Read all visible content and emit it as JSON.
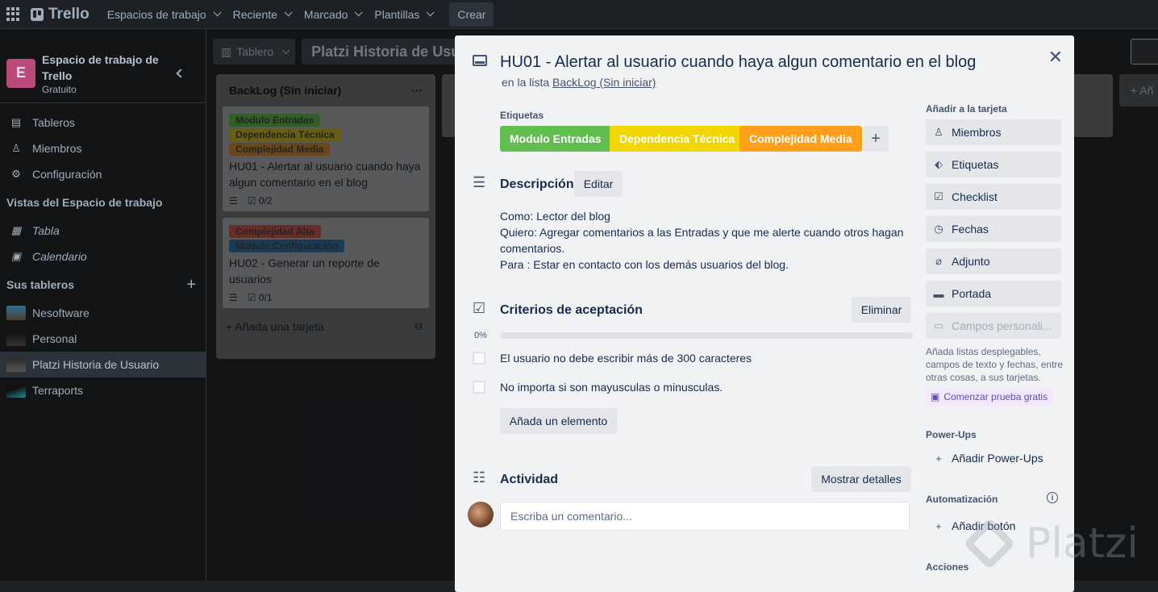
{
  "topbar": {
    "logo": "Trello",
    "nav": [
      "Espacios de trabajo",
      "Reciente",
      "Marcado",
      "Plantillas"
    ],
    "create": "Crear"
  },
  "sidebar": {
    "workspace_initial": "E",
    "workspace_name": "Espacio de trabajo de Trello",
    "workspace_plan": "Gratuito",
    "items": [
      {
        "label": "Tableros",
        "icon": "board-icon"
      },
      {
        "label": "Miembros",
        "icon": "person-icon"
      },
      {
        "label": "Configuración",
        "icon": "gear-icon"
      }
    ],
    "views_header": "Vistas del Espacio de trabajo",
    "views": [
      {
        "label": "Tabla",
        "icon": "table-icon"
      },
      {
        "label": "Calendario",
        "icon": "calendar-icon"
      }
    ],
    "boards_header": "Sus tableros",
    "boards": [
      {
        "label": "Nesoftware",
        "color": "#3b6f8a"
      },
      {
        "label": "Personal",
        "color": "#2a2a2a"
      },
      {
        "label": "Platzi Historia de Usuario",
        "color": "#3c3c3c"
      },
      {
        "label": "Terraports",
        "color": "#1d6c7a"
      }
    ]
  },
  "board": {
    "view": "Tablero",
    "title": "Platzi Historia de Usuario",
    "list": {
      "title": "BackLog (Sin iniciar)",
      "cards": [
        {
          "labels": [
            {
              "text": "Modulo Entradas",
              "color": "#4e9a3d"
            },
            {
              "text": "Dependencia Técnica",
              "color": "#a59a22"
            },
            {
              "text": "Complejidad Media",
              "color": "#a8742a"
            }
          ],
          "title": "HU01 - Alertar al usuario cuando haya algun comentario en el blog",
          "checklist": "0/2"
        },
        {
          "labels": [
            {
              "text": "Complejidad Alta",
              "color": "#a84a3e"
            },
            {
              "text": "Modulo Configuración",
              "color": "#2d5f86"
            }
          ],
          "title": "HU02 - Generar un reporte de usuarios",
          "checklist": "0/1"
        }
      ],
      "add_card": "Añada una tarjeta"
    },
    "add_list_short": "+ Añ"
  },
  "modal": {
    "title": "HU01 - Alertar al usuario cuando haya algun comentario en el blog",
    "in_list_prefix": "en la lista",
    "in_list_name": "BackLog (Sin iniciar)",
    "labels_heading": "Etiquetas",
    "labels": [
      {
        "text": "Modulo Entradas",
        "color": "#61bd4f"
      },
      {
        "text": "Dependencia Técnica",
        "color": "#f2d600"
      },
      {
        "text": "Complejidad Media",
        "color": "#ff9f1a"
      }
    ],
    "description_heading": "Descripción",
    "edit": "Editar",
    "description": [
      "Como: Lector del blog",
      "Quiero: Agregar comentarios a las Entradas y que me alerte cuando otros hagan comentarios.",
      "Para : Estar en contacto con los demás usuarios del blog."
    ],
    "checklist_heading": "Criterios de aceptación",
    "delete": "Eliminar",
    "progress_label": "0%",
    "progress": 0,
    "checklist_items": [
      "El usuario no debe escribir más de 300 caracteres",
      "No importa si son mayusculas o minusculas."
    ],
    "add_item": "Añada un elemento",
    "activity_heading": "Actividad",
    "show_details": "Mostrar detalles",
    "comment_placeholder": "Escriba un comentario..."
  },
  "side": {
    "add_heading": "Añadir a la tarjeta",
    "buttons": [
      {
        "label": "Miembros",
        "icon": "person-icon"
      },
      {
        "label": "Etiquetas",
        "icon": "tag-icon"
      },
      {
        "label": "Checklist",
        "icon": "checkbox-icon"
      },
      {
        "label": "Fechas",
        "icon": "clock-icon"
      },
      {
        "label": "Adjunto",
        "icon": "paperclip-icon"
      },
      {
        "label": "Portada",
        "icon": "cover-icon"
      }
    ],
    "custom_fields": "Campos personali...",
    "custom_note": "Añada listas desplegables, campos de texto y fechas, entre otras cosas, a sus tarjetas.",
    "trial": "Comenzar prueba gratis",
    "powerups_heading": "Power-Ups",
    "add_powerups": "Añadir Power-Ups",
    "automation_heading": "Automatización",
    "add_button": "Añadir botón",
    "actions_heading": "Acciones"
  },
  "watermark": "Platzi"
}
